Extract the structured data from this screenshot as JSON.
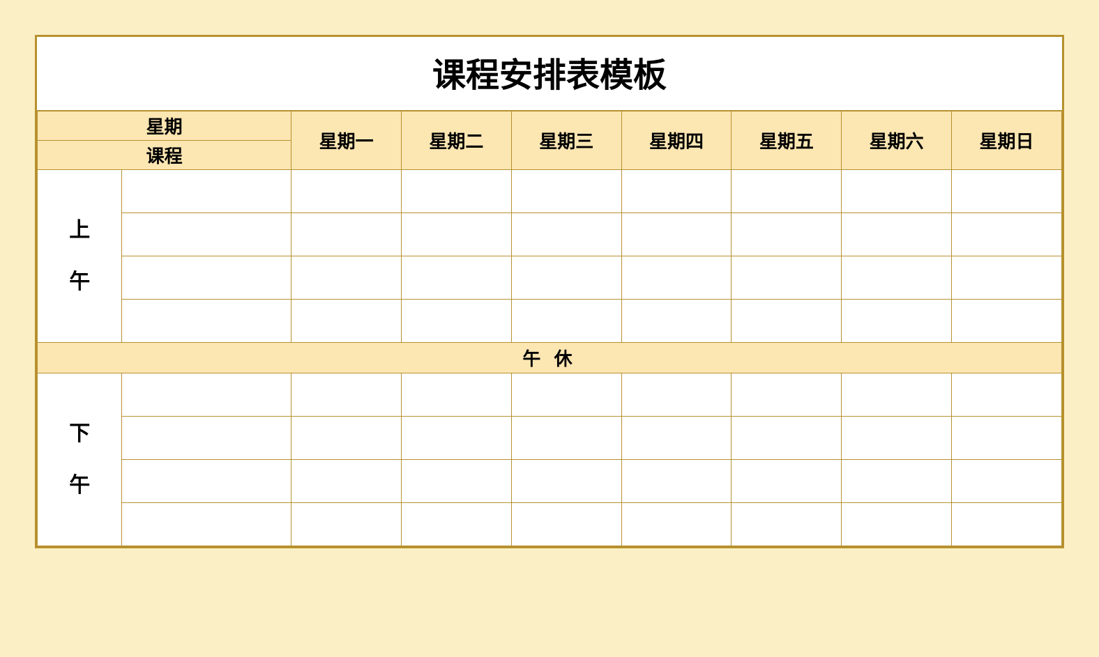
{
  "title": "课程安排表模板",
  "header": {
    "weekday_label": "星期",
    "course_label": "课程",
    "days": [
      "星期一",
      "星期二",
      "星期三",
      "星期四",
      "星期五",
      "星期六",
      "星期日"
    ]
  },
  "sessions": {
    "morning": "上\n\n午",
    "morning_char1": "上",
    "morning_char2": "午",
    "afternoon_char1": "下",
    "afternoon_char2": "午",
    "break": "午 休"
  }
}
